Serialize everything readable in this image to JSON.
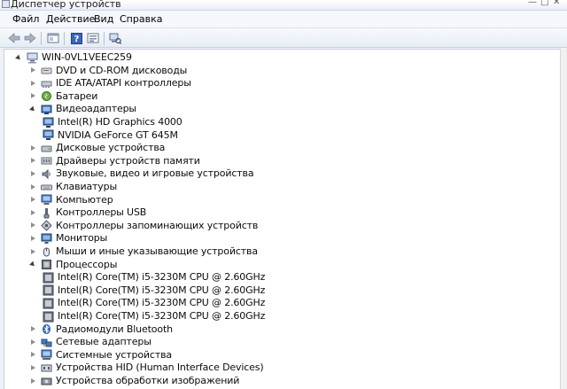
{
  "window": {
    "title": "Диспетчер устройств"
  },
  "menu": [
    "Файл",
    "Действие",
    "Вид",
    "Справка"
  ],
  "toolbar_icons": [
    "back-arrow-icon",
    "forward-arrow-icon",
    "properties-window-icon",
    "help-icon",
    "device-view-icon",
    "scan-hardware-icon"
  ],
  "tree": {
    "root": "WIN-0VL1VEEC259",
    "items": [
      {
        "label": "DVD и CD-ROM дисководы",
        "icon": "dvd-drive-icon",
        "expanded": false
      },
      {
        "label": "IDE ATA/ATAPI контроллеры",
        "icon": "ide-controller-icon",
        "expanded": false
      },
      {
        "label": "Батареи",
        "icon": "battery-icon",
        "expanded": false
      },
      {
        "label": "Видеоадаптеры",
        "icon": "display-adapter-icon",
        "expanded": true,
        "children": [
          "Intel(R) HD Graphics 4000",
          "NVIDIA GeForce GT 645M"
        ]
      },
      {
        "label": "Дисковые устройства",
        "icon": "disk-drive-icon",
        "expanded": false
      },
      {
        "label": "Драйверы устройств памяти",
        "icon": "memory-device-icon",
        "expanded": false
      },
      {
        "label": "Звуковые, видео и игровые устройства",
        "icon": "sound-device-icon",
        "expanded": false
      },
      {
        "label": "Клавиатуры",
        "icon": "keyboard-icon",
        "expanded": false
      },
      {
        "label": "Компьютер",
        "icon": "computer-icon",
        "expanded": false
      },
      {
        "label": "Контроллеры USB",
        "icon": "usb-icon",
        "expanded": false
      },
      {
        "label": "Контроллеры запоминающих устройств",
        "icon": "storage-controller-icon",
        "expanded": false
      },
      {
        "label": "Мониторы",
        "icon": "monitor-icon",
        "expanded": false
      },
      {
        "label": "Мыши и иные указывающие устройства",
        "icon": "mouse-icon",
        "expanded": false
      },
      {
        "label": "Процессоры",
        "icon": "processor-icon",
        "expanded": true,
        "children": [
          "Intel(R) Core(TM) i5-3230M CPU @ 2.60GHz",
          "Intel(R) Core(TM) i5-3230M CPU @ 2.60GHz",
          "Intel(R) Core(TM) i5-3230M CPU @ 2.60GHz",
          "Intel(R) Core(TM) i5-3230M CPU @ 2.60GHz"
        ]
      },
      {
        "label": "Радиомодули Bluetooth",
        "icon": "bluetooth-icon",
        "expanded": false
      },
      {
        "label": "Сетевые адаптеры",
        "icon": "network-adapter-icon",
        "expanded": false
      },
      {
        "label": "Системные устройства",
        "icon": "system-device-icon",
        "expanded": false
      },
      {
        "label": "Устройства HID (Human Interface Devices)",
        "icon": "hid-icon",
        "expanded": false
      },
      {
        "label": "Устройства обработки изображений",
        "icon": "imaging-device-icon",
        "expanded": false
      }
    ]
  }
}
